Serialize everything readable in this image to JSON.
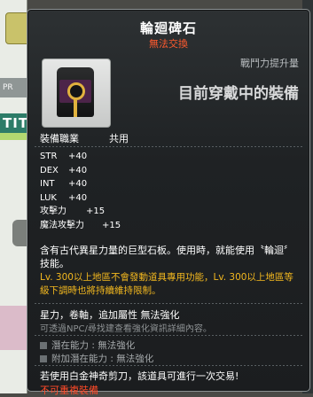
{
  "background": {
    "left_strip_pre": "PR",
    "left_strip_title": "TITLE"
  },
  "tooltip": {
    "item_name": "輪廻碑石",
    "trade_status": "無法交換",
    "combat_power_label": "戰鬥力提升量",
    "combat_power_value": "目前穿戴中的裝備",
    "job_label": "裝備職業",
    "job_value": "共用",
    "stats": [
      {
        "name": "STR",
        "value": "+40"
      },
      {
        "name": "DEX",
        "value": "+40"
      },
      {
        "name": "INT",
        "value": "+40"
      },
      {
        "name": "LUK",
        "value": "+40"
      },
      {
        "name": "攻擊力",
        "value": "+15"
      },
      {
        "name": "魔法攻擊力",
        "value": "+15"
      }
    ],
    "description": "含有古代異星力量的巨型石板。使用時，就能使用〝輪迴〞技能。",
    "warning": "Lv. 300以上地區不會發動道具專用功能，Lv. 300以上地區等級下調時也將持續維持限制。",
    "enhancement": "星力，卷軸，追加屬性 無法強化",
    "enhancement_note": "可透過NPC/尋找建查看強化資訊詳細內容。",
    "potential": "潛在能力 : 無法強化",
    "bonus_potential": "附加潛在能力 : 無法強化",
    "scissors_note": "若使用白金神奇剪刀，該道具可進行一次交易!",
    "unique_note": "不可重複裝備"
  },
  "colors": {
    "title": "#ffffff",
    "trade_status": "#ff5a2e",
    "warning": "#f3b81f",
    "unique_note": "#ff4a28"
  },
  "icons": {
    "item_icon": "reincarnation-stone-icon"
  }
}
